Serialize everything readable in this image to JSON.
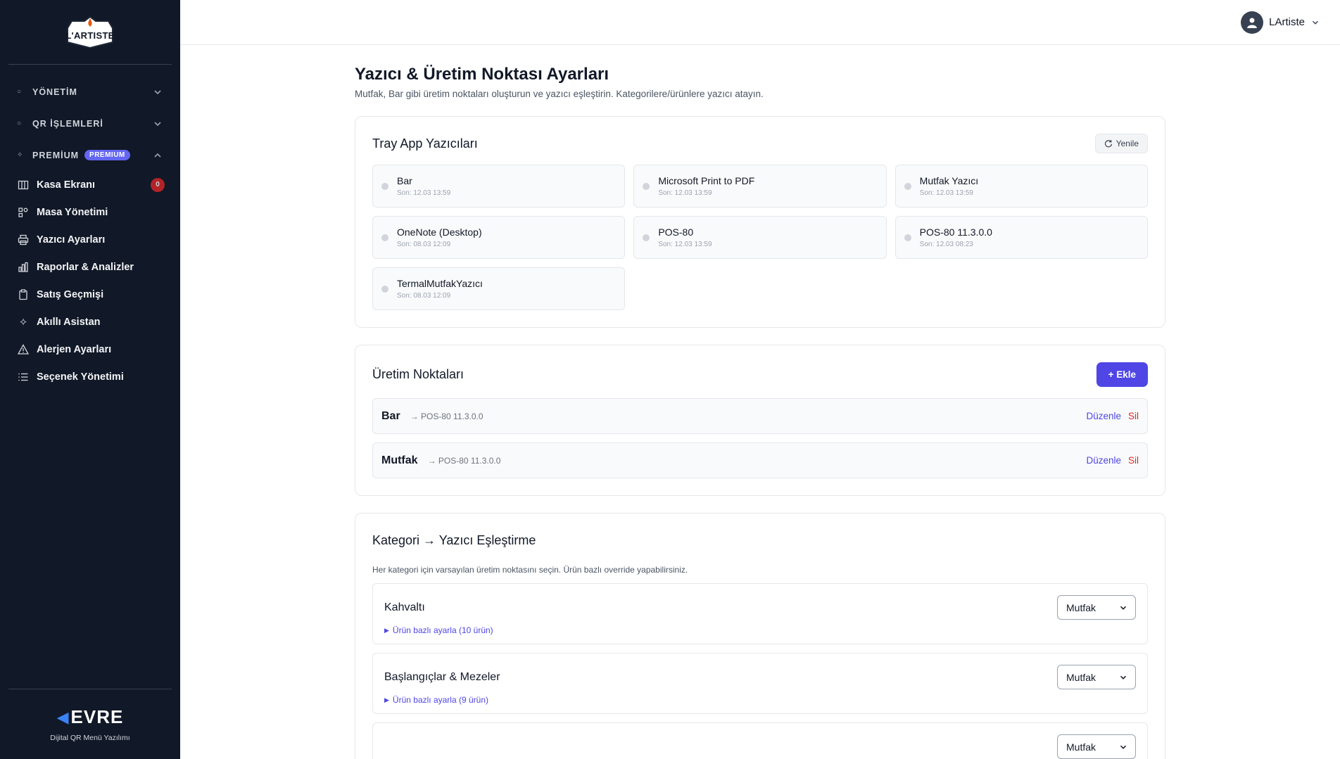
{
  "brand": {
    "logo_text": "L'ARTISTE"
  },
  "sidebar": {
    "sections": [
      {
        "label": "YÖNETİM"
      },
      {
        "label": "QR İŞLEMLERİ"
      },
      {
        "label": "PREMİUM",
        "pill": "PREMIUM"
      }
    ],
    "items": [
      {
        "label": "Kasa Ekranı",
        "icon": "columns-icon",
        "badge": "0"
      },
      {
        "label": "Masa Yönetimi",
        "icon": "tables-icon"
      },
      {
        "label": "Yazıcı Ayarları",
        "icon": "printer-icon"
      },
      {
        "label": "Raporlar & Analizler",
        "icon": "bar-chart-icon"
      },
      {
        "label": "Satış Geçmişi",
        "icon": "clipboard-icon"
      },
      {
        "label": "Akıllı Asistan",
        "icon": "sparkle-icon"
      },
      {
        "label": "Alerjen Ayarları",
        "icon": "warning-icon"
      },
      {
        "label": "Seçenek Yönetimi",
        "icon": "list-icon"
      }
    ],
    "footer": {
      "logo": "EVRE",
      "caption": "Dijital QR Menü Yazılımı"
    }
  },
  "topbar": {
    "user_name": "LArtiste"
  },
  "page": {
    "title": "Yazıcı & Üretim Noktası Ayarları",
    "subtitle": "Mutfak, Bar gibi üretim noktaları oluşturun ve yazıcı eşleştirin. Kategorilere/ürünlere yazıcı atayın."
  },
  "tray": {
    "title": "Tray App Yazıcıları",
    "refresh_label": "Yenile",
    "printers": [
      {
        "name": "Bar",
        "time": "Son: 12.03 13:59"
      },
      {
        "name": "Microsoft Print to PDF",
        "time": "Son: 12.03 13:59"
      },
      {
        "name": "Mutfak Yazıcı",
        "time": "Son: 12.03 13:59"
      },
      {
        "name": "OneNote (Desktop)",
        "time": "Son: 08.03 12:09"
      },
      {
        "name": "POS-80",
        "time": "Son: 12.03 13:59"
      },
      {
        "name": "POS-80 11.3.0.0",
        "time": "Son: 12.03 08:23"
      },
      {
        "name": "TermalMutfakYazıcı",
        "time": "Son: 08.03 12:09"
      }
    ]
  },
  "points": {
    "title": "Üretim Noktaları",
    "add_label": "+ Ekle",
    "edit_label": "Düzenle",
    "delete_label": "Sil",
    "rows": [
      {
        "name": "Bar",
        "printer": "→ POS-80 11.3.0.0"
      },
      {
        "name": "Mutfak",
        "printer": "→ POS-80 11.3.0.0"
      }
    ]
  },
  "mapping": {
    "title": "Kategori → Yazıcı Eşleştirme",
    "hint": "Her kategori için varsayılan üretim noktasını seçin. Ürün bazlı override yapabilirsiniz.",
    "categories": [
      {
        "name": "Kahvaltı",
        "selected": "Mutfak",
        "link": "Ürün bazlı ayarla (10 ürün)"
      },
      {
        "name": "Başlangıçlar & Mezeler",
        "selected": "Mutfak",
        "link": "Ürün bazlı ayarla (9 ürün)"
      },
      {
        "name": "",
        "selected": "Mutfak",
        "link": ""
      }
    ]
  }
}
